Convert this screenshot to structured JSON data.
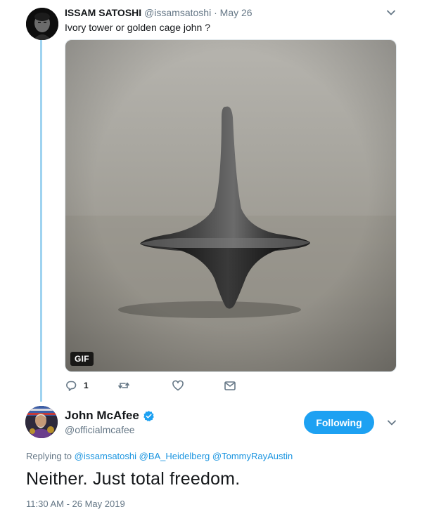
{
  "tweet1": {
    "author_name": "ISSAM SATOSHI",
    "author_handle": "@issamsatoshi",
    "separator": "·",
    "date": "May 26",
    "text": "Ivory tower or golden cage john ?",
    "media_badge": "GIF",
    "reply_count": "1",
    "icons": [
      "avatar",
      "chevron-down-icon",
      "reply-icon",
      "retweet-icon",
      "like-icon",
      "direct-message-icon"
    ]
  },
  "tweet2": {
    "author_name": "John McAfee",
    "author_handle": "@officialmcafee",
    "follow_label": "Following",
    "replying_prefix": "Replying to",
    "mentions": [
      "@issamsatoshi",
      "@BA_Heidelberg",
      "@TommyRayAustin"
    ],
    "text": "Neither. Just total freedom.",
    "timestamp": "11:30 AM - 26 May 2019",
    "icons": [
      "verified-badge-icon",
      "chevron-down-icon"
    ]
  },
  "colors": {
    "accent": "#1da1f2",
    "mention": "#1b95e0",
    "muted_text": "#657786",
    "thread_line": "#9fd3f0",
    "primary_text": "#14171a"
  }
}
